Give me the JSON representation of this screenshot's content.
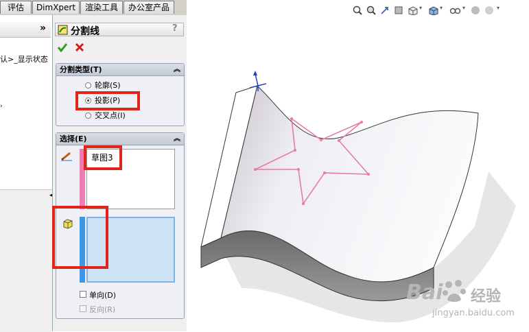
{
  "tabs": [
    "评估",
    "DimXpert",
    "渲染工具",
    "办公室产品"
  ],
  "left_panel": {
    "collapse_label": "»",
    "tree_text": "认>_显示状态"
  },
  "property_manager": {
    "title": "分割线",
    "help_label": "?",
    "ok_icon": "check-icon",
    "cancel_icon": "close-x-icon",
    "split_type": {
      "heading": "分割类型(T)",
      "options": [
        "轮廓(S)",
        "投影(P)",
        "交叉点(I)"
      ],
      "selected": "投影(P)"
    },
    "selection": {
      "heading": "选择(E)",
      "sketch_item": "草图3",
      "single_direction_label": "单向(D)",
      "reverse_label": "反向(R)"
    }
  },
  "viewport": {
    "sketch_color": "#e879a8",
    "face_color": "#efeef3"
  },
  "watermark": {
    "brand": "Bai",
    "brand_suffix": "经验",
    "url": "jingyan.baidu.com"
  }
}
